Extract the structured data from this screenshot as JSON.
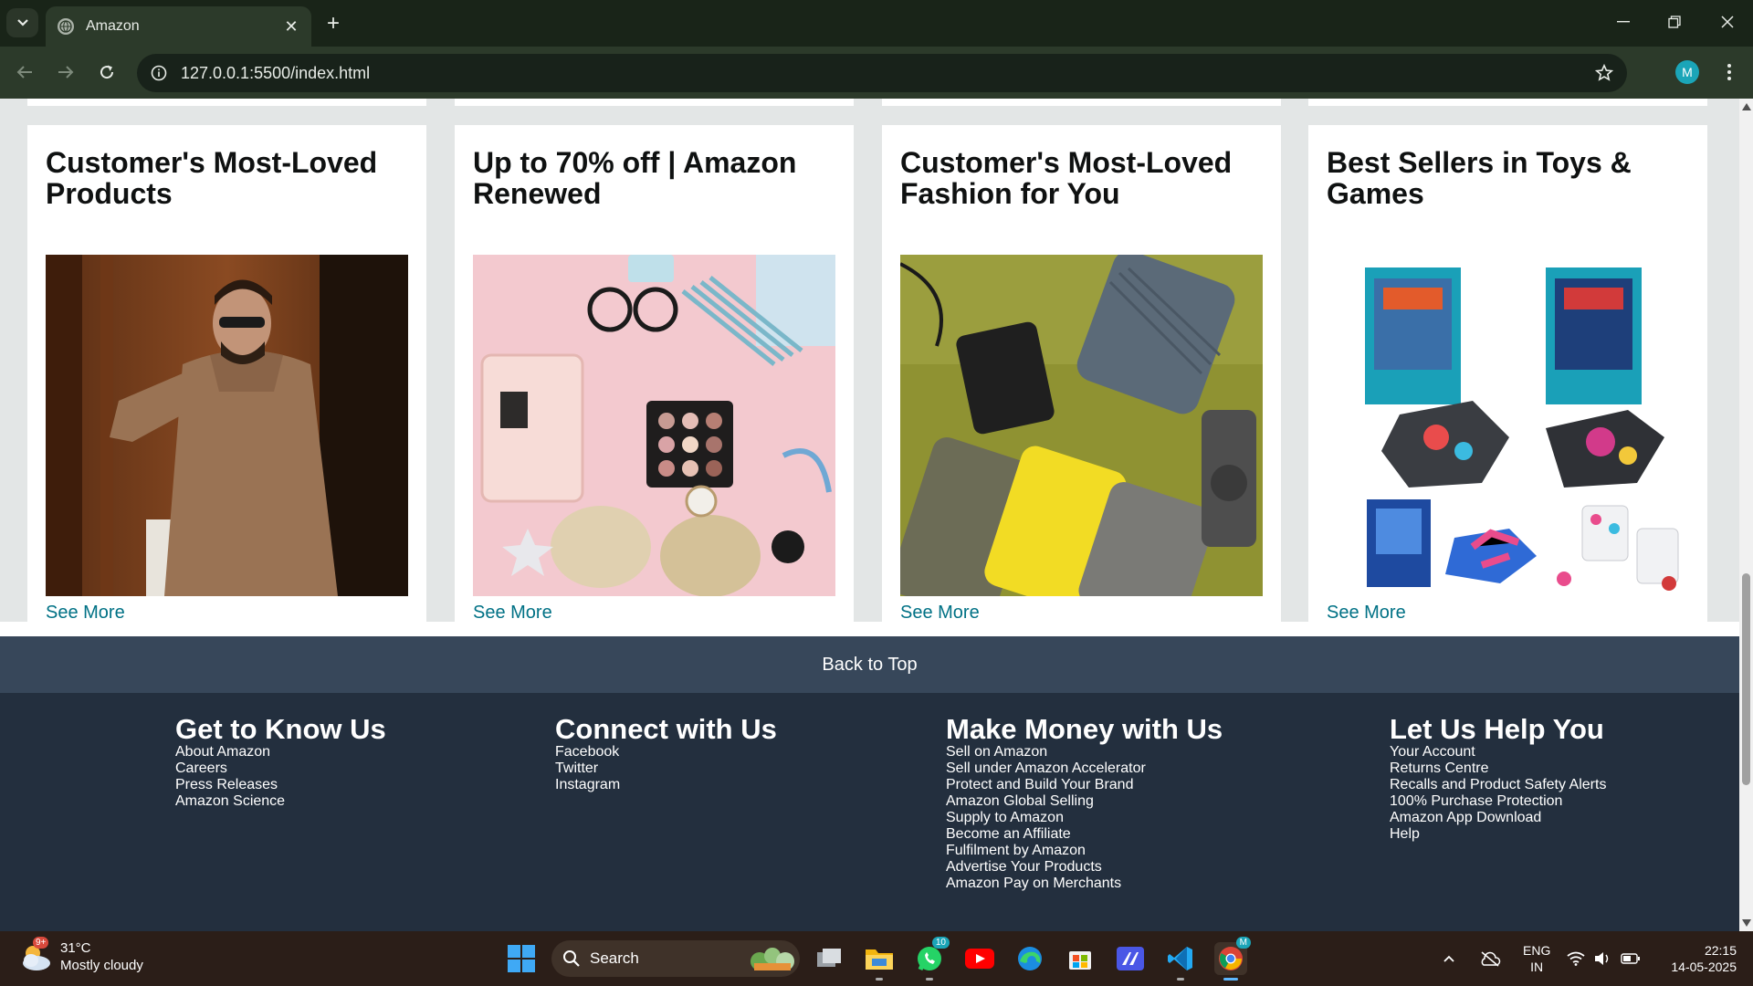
{
  "browser": {
    "tab_title": "Amazon",
    "new_tab_symbol": "+",
    "close_symbol": "✕",
    "url": "127.0.0.1:5500/index.html",
    "profile_initial": "M"
  },
  "cards": [
    {
      "title": "Customer's Most-Loved Products",
      "link": "See More",
      "image": "man-in-brown-shirt-photo"
    },
    {
      "title": "Up to 70% off | Amazon Renewed",
      "link": "See More",
      "image": "makeup-flatlay-photo"
    },
    {
      "title": "Customer's Most-Loved Fashion for You",
      "link": "See More",
      "image": "power-banks-photo"
    },
    {
      "title": "Best Sellers in Toys & Games",
      "link": "See More",
      "image": "board-games-photo"
    }
  ],
  "back_to_top": "Back to Top",
  "footer": {
    "columns": [
      {
        "title": "Get to Know Us",
        "links": [
          "About Amazon",
          "Careers",
          "Press Releases",
          "Amazon Science"
        ]
      },
      {
        "title": "Connect with Us",
        "links": [
          "Facebook",
          "Twitter",
          "Instagram"
        ]
      },
      {
        "title": "Make Money with Us",
        "links": [
          "Sell on Amazon",
          "Sell under Amazon Accelerator",
          "Protect and Build Your Brand",
          "Amazon Global Selling",
          "Supply to Amazon",
          "Become an Affiliate",
          "Fulfilment by Amazon",
          "Advertise Your Products",
          "Amazon Pay on Merchants"
        ]
      },
      {
        "title": "Let Us Help You",
        "links": [
          "Your Account",
          "Returns Centre",
          "Recalls and Product Safety Alerts",
          "100% Purchase Protection",
          "Amazon App Download",
          "Help"
        ]
      }
    ]
  },
  "taskbar": {
    "weather_temp": "31°C",
    "weather_desc": "Mostly cloudy",
    "weather_badge": "9+",
    "search_label": "Search",
    "whatsapp_badge": "10",
    "chrome_badge": "M",
    "lang_line1": "ENG",
    "lang_line2": "IN",
    "time": "22:15",
    "date": "14-05-2025"
  },
  "colors": {
    "link": "#007185",
    "footer_bg": "#232f3e",
    "back_to_top_bg": "#37475a"
  }
}
